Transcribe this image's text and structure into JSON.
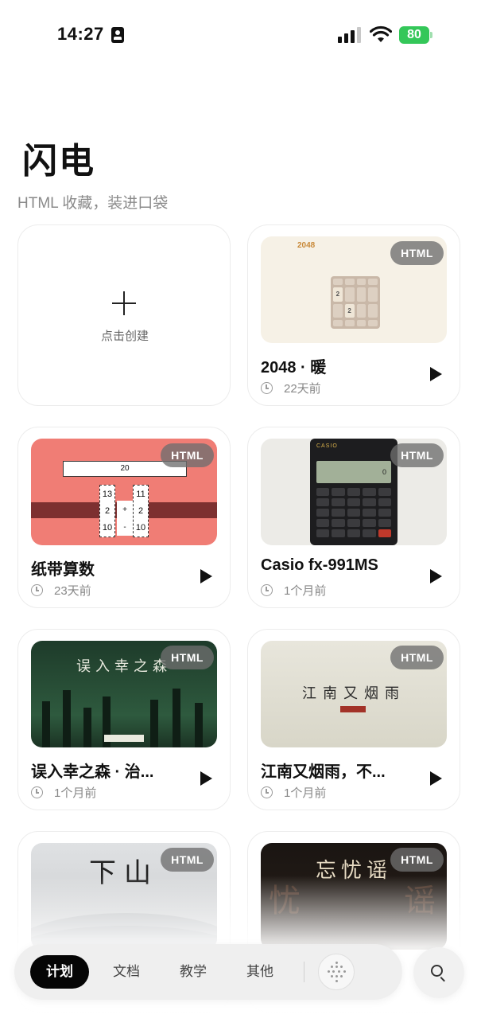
{
  "status_bar": {
    "time": "14:27",
    "battery": "80",
    "icons": [
      "contact-card-icon",
      "cellular-signal-icon",
      "wifi-icon",
      "battery-icon"
    ]
  },
  "header": {
    "title": "闪电",
    "subtitle": "HTML 收藏，装进口袋"
  },
  "create_card": {
    "label": "点击创建",
    "icon": "plus-icon"
  },
  "badge_label": "HTML",
  "cards": [
    {
      "title": "2048 · 暖",
      "time": "22天前",
      "thumb": {
        "logo": "2048",
        "tiles": [
          "2",
          "2"
        ]
      }
    },
    {
      "title": "纸带算数",
      "time": "23天前",
      "thumb": {
        "header": "纸带算数",
        "value": "20",
        "left_col": [
          "13",
          "2",
          "10"
        ],
        "right_col": [
          "11",
          "2",
          "10"
        ],
        "ops": [
          "+",
          "-"
        ]
      }
    },
    {
      "title": "Casio fx-991MS",
      "time": "1个月前",
      "thumb": {
        "brand": "CASIO",
        "display": "0"
      }
    },
    {
      "title": "江南又烟雨，不...",
      "time": "1个月前",
      "thumb": {
        "heading": "江南又烟雨"
      }
    },
    {
      "title": "误入幸之森 · 治...",
      "time": "1个月前",
      "thumb": {
        "heading": "误入幸之森"
      }
    },
    {
      "title": "",
      "time": "",
      "thumb": {
        "heading": "下山"
      }
    },
    {
      "title": "",
      "time": "",
      "thumb": {
        "heading": "忘忧谣",
        "ghost": [
          "忧",
          "谣"
        ]
      }
    }
  ],
  "tabbar": {
    "tabs": [
      "计划",
      "文档",
      "教学",
      "其他"
    ],
    "active": "计划",
    "icons": [
      "voice-orb-icon",
      "search-icon"
    ]
  },
  "colors": {
    "accent": "#050505",
    "battery": "#34c759",
    "badge": "#6e6e6e"
  }
}
